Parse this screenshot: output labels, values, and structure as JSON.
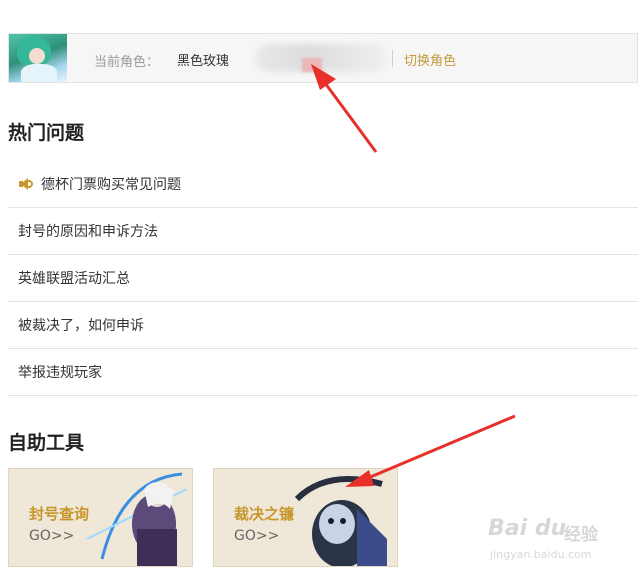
{
  "role_bar": {
    "label": "当前角色：",
    "name": "黑色玫瑰",
    "switch": "切换角色"
  },
  "hot": {
    "title": "热门问题",
    "items": [
      "德杯门票购买常见问题",
      "封号的原因和申诉方法",
      "英雄联盟活动汇总",
      "被裁决了，如何申诉",
      "举报违规玩家"
    ]
  },
  "tools": {
    "title": "自助工具",
    "cards": [
      {
        "name": "封号查询",
        "go": "GO>>"
      },
      {
        "name": "裁决之镰",
        "go": "GO>>"
      }
    ]
  },
  "watermark": {
    "logo": "Bai du",
    "text": "经验",
    "url": "jingyan.baidu.com"
  },
  "colors": {
    "accent": "#c49a3b",
    "arrow": "#e8302a"
  }
}
